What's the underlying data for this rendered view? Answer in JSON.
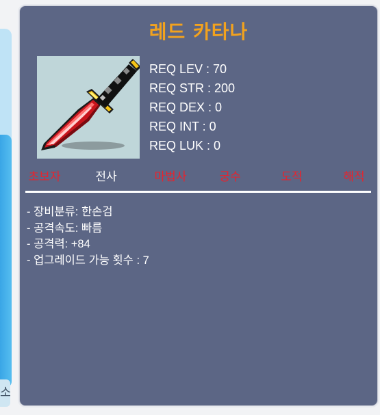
{
  "item": {
    "name": "레드 카타나",
    "icon": "red-katana-icon"
  },
  "requirements": [
    "REQ LEV : 70",
    "REQ STR : 200",
    "REQ DEX : 0",
    "REQ INT : 0",
    "REQ LUK : 0"
  ],
  "jobs": [
    {
      "label": "초보자",
      "enabled": false
    },
    {
      "label": "전사",
      "enabled": true
    },
    {
      "label": "마법사",
      "enabled": false
    },
    {
      "label": "궁수",
      "enabled": false
    },
    {
      "label": "도적",
      "enabled": false
    },
    {
      "label": "해적",
      "enabled": false
    }
  ],
  "stats": [
    "- 장비분류: 한손검",
    "- 공격속도: 빠름",
    "- 공격력: +84",
    "- 업그레이드 가능 횟수 : 7"
  ],
  "colors": {
    "title": "#f2a21e",
    "job_enabled": "#ffffff",
    "job_disabled": "#e8232d",
    "panel_bg": "#5c6685"
  },
  "sidebar": {
    "glyph": "소"
  }
}
